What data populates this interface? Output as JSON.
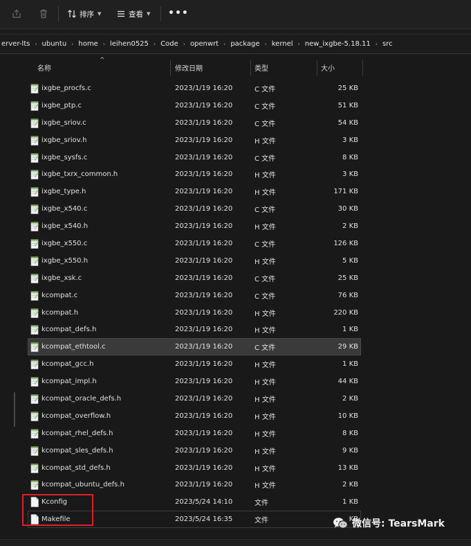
{
  "toolbar": {
    "sort_label": "排序",
    "view_label": "查看",
    "more_label": "•••",
    "icons": [
      "share-icon",
      "delete-icon",
      "sort-icon",
      "view-icon"
    ]
  },
  "breadcrumb": [
    "erver-lts",
    "ubuntu",
    "home",
    "leihen0525",
    "Code",
    "openwrt",
    "package",
    "kernel",
    "new_ixgbe-5.18.11",
    "src"
  ],
  "columns": {
    "name": "名称",
    "date": "修改日期",
    "type": "类型",
    "size": "大小"
  },
  "files": [
    {
      "name": "ixgbe_procfs.c",
      "date": "2023/1/19 16:20",
      "type": "C 文件",
      "size": "25 KB",
      "icon": "c"
    },
    {
      "name": "ixgbe_ptp.c",
      "date": "2023/1/19 16:20",
      "type": "C 文件",
      "size": "51 KB",
      "icon": "c"
    },
    {
      "name": "ixgbe_sriov.c",
      "date": "2023/1/19 16:20",
      "type": "C 文件",
      "size": "54 KB",
      "icon": "c"
    },
    {
      "name": "ixgbe_sriov.h",
      "date": "2023/1/19 16:20",
      "type": "H 文件",
      "size": "3 KB",
      "icon": "h"
    },
    {
      "name": "ixgbe_sysfs.c",
      "date": "2023/1/19 16:20",
      "type": "C 文件",
      "size": "8 KB",
      "icon": "c"
    },
    {
      "name": "ixgbe_txrx_common.h",
      "date": "2023/1/19 16:20",
      "type": "H 文件",
      "size": "3 KB",
      "icon": "h"
    },
    {
      "name": "ixgbe_type.h",
      "date": "2023/1/19 16:20",
      "type": "H 文件",
      "size": "171 KB",
      "icon": "h"
    },
    {
      "name": "ixgbe_x540.c",
      "date": "2023/1/19 16:20",
      "type": "C 文件",
      "size": "30 KB",
      "icon": "c"
    },
    {
      "name": "ixgbe_x540.h",
      "date": "2023/1/19 16:20",
      "type": "H 文件",
      "size": "2 KB",
      "icon": "h"
    },
    {
      "name": "ixgbe_x550.c",
      "date": "2023/1/19 16:20",
      "type": "C 文件",
      "size": "126 KB",
      "icon": "c"
    },
    {
      "name": "ixgbe_x550.h",
      "date": "2023/1/19 16:20",
      "type": "H 文件",
      "size": "5 KB",
      "icon": "h"
    },
    {
      "name": "ixgbe_xsk.c",
      "date": "2023/1/19 16:20",
      "type": "C 文件",
      "size": "25 KB",
      "icon": "c"
    },
    {
      "name": "kcompat.c",
      "date": "2023/1/19 16:20",
      "type": "C 文件",
      "size": "76 KB",
      "icon": "c"
    },
    {
      "name": "kcompat.h",
      "date": "2023/1/19 16:20",
      "type": "H 文件",
      "size": "220 KB",
      "icon": "h"
    },
    {
      "name": "kcompat_defs.h",
      "date": "2023/1/19 16:20",
      "type": "H 文件",
      "size": "1 KB",
      "icon": "h"
    },
    {
      "name": "kcompat_ethtool.c",
      "date": "2023/1/19 16:20",
      "type": "C 文件",
      "size": "29 KB",
      "icon": "c",
      "selected": true
    },
    {
      "name": "kcompat_gcc.h",
      "date": "2023/1/19 16:20",
      "type": "H 文件",
      "size": "1 KB",
      "icon": "h"
    },
    {
      "name": "kcompat_impl.h",
      "date": "2023/1/19 16:20",
      "type": "H 文件",
      "size": "44 KB",
      "icon": "h"
    },
    {
      "name": "kcompat_oracle_defs.h",
      "date": "2023/1/19 16:20",
      "type": "H 文件",
      "size": "2 KB",
      "icon": "h"
    },
    {
      "name": "kcompat_overflow.h",
      "date": "2023/1/19 16:20",
      "type": "H 文件",
      "size": "10 KB",
      "icon": "h"
    },
    {
      "name": "kcompat_rhel_defs.h",
      "date": "2023/1/19 16:20",
      "type": "H 文件",
      "size": "8 KB",
      "icon": "h"
    },
    {
      "name": "kcompat_sles_defs.h",
      "date": "2023/1/19 16:20",
      "type": "H 文件",
      "size": "9 KB",
      "icon": "h"
    },
    {
      "name": "kcompat_std_defs.h",
      "date": "2023/1/19 16:20",
      "type": "H 文件",
      "size": "13 KB",
      "icon": "h"
    },
    {
      "name": "kcompat_ubuntu_defs.h",
      "date": "2023/1/19 16:20",
      "type": "H 文件",
      "size": "2 KB",
      "icon": "h"
    },
    {
      "name": "Kconfig",
      "date": "2023/5/24 14:10",
      "type": "文件",
      "size": "1 KB",
      "icon": "plain"
    },
    {
      "name": "Makefile",
      "date": "2023/5/24 16:35",
      "type": "文件",
      "size": "KB",
      "icon": "plain"
    }
  ],
  "watermark": {
    "text": "微信号: TearsMark",
    "icon": "wechat-icon"
  },
  "colors": {
    "highlight_box": "#e0202a",
    "selected_row": "#3a3a3a",
    "background": "#191919"
  }
}
